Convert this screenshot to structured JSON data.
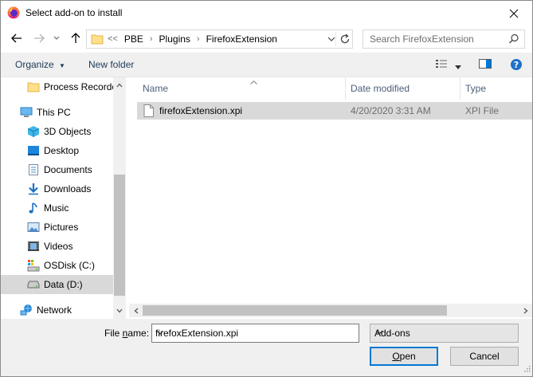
{
  "window": {
    "title": "Select add-on to install"
  },
  "address": {
    "overflow": "<<",
    "crumbs": [
      "PBE",
      "Plugins",
      "FirefoxExtension"
    ]
  },
  "search": {
    "placeholder": "Search FirefoxExtension"
  },
  "toolbar": {
    "organize_label": "Organize",
    "new_folder_label": "New folder"
  },
  "nav": {
    "items": [
      {
        "label": "Process Recorde",
        "icon": "folder-icon"
      },
      {
        "label": "This PC",
        "icon": "computer-icon"
      },
      {
        "label": "3D Objects",
        "icon": "cube-icon"
      },
      {
        "label": "Desktop",
        "icon": "desktop-icon"
      },
      {
        "label": "Documents",
        "icon": "document-icon"
      },
      {
        "label": "Downloads",
        "icon": "download-icon"
      },
      {
        "label": "Music",
        "icon": "music-icon"
      },
      {
        "label": "Pictures",
        "icon": "picture-icon"
      },
      {
        "label": "Videos",
        "icon": "video-icon"
      },
      {
        "label": "OSDisk (C:)",
        "icon": "system-drive-icon"
      },
      {
        "label": "Data (D:)",
        "icon": "drive-icon",
        "selected": true
      },
      {
        "label": "Network",
        "icon": "network-icon"
      }
    ]
  },
  "columns": {
    "name": "Name",
    "date": "Date modified",
    "type": "Type"
  },
  "files": [
    {
      "name": "firefoxExtension.xpi",
      "date": "4/20/2020 3:31 AM",
      "type": "XPI File"
    }
  ],
  "bottom": {
    "filename_label_pre": "File ",
    "filename_label_accel": "n",
    "filename_label_post": "ame:",
    "filename_value": "firefoxExtension.xpi",
    "filetype_value": "Add-ons",
    "open_accel": "O",
    "open_rest": "pen",
    "cancel_label": "Cancel"
  },
  "colors": {
    "accent": "#0078d7",
    "selection": "#d9d9d9",
    "panel": "#f0f0f0"
  }
}
